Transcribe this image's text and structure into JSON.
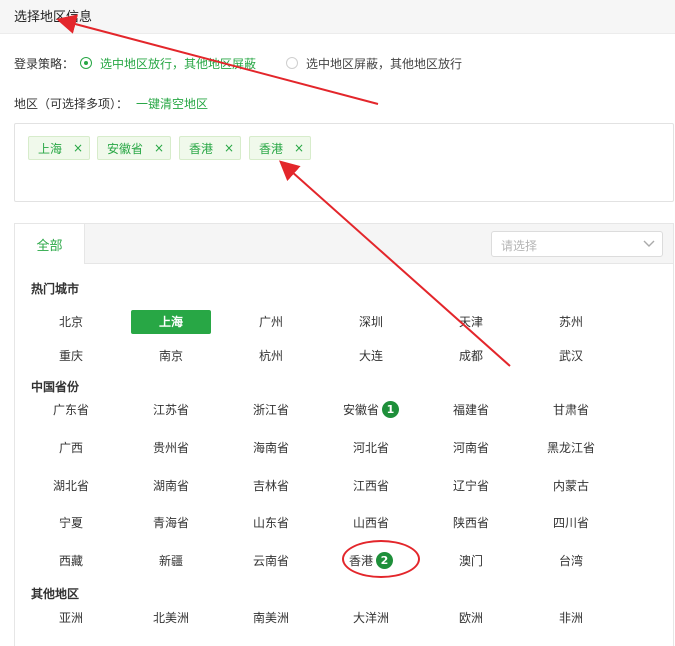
{
  "header": {
    "title": "选择地区信息"
  },
  "policy": {
    "label": "登录策略：",
    "options": [
      {
        "label": "选中地区放行，其他地区屏蔽",
        "selected": true
      },
      {
        "label": "选中地区屏蔽，其他地区放行",
        "selected": false
      }
    ]
  },
  "area": {
    "label": "地区（可选择多项）：",
    "clear_link": "一键清空地区"
  },
  "tags": [
    {
      "label": "上海",
      "close": "×"
    },
    {
      "label": "安徽省",
      "close": "×"
    },
    {
      "label": "香港",
      "close": "×"
    },
    {
      "label": "香港",
      "close": "×"
    }
  ],
  "panel": {
    "tab_all": "全部",
    "select_placeholder": "请选择",
    "sections": [
      {
        "title": "热门城市",
        "rows": [
          [
            "北京",
            "上海",
            "广州",
            "深圳",
            "天津",
            "苏州"
          ],
          [
            "重庆",
            "南京",
            "杭州",
            "大连",
            "成都",
            "武汉"
          ]
        ]
      },
      {
        "title": "中国省份",
        "rows": [
          [
            "广东省",
            "江苏省",
            "浙江省",
            "安徽省",
            "福建省",
            "甘肃省"
          ],
          [
            "广西",
            "贵州省",
            "海南省",
            "河北省",
            "河南省",
            "黑龙江省"
          ],
          [
            "湖北省",
            "湖南省",
            "吉林省",
            "江西省",
            "辽宁省",
            "内蒙古"
          ],
          [
            "宁夏",
            "青海省",
            "山东省",
            "山西省",
            "陕西省",
            "四川省"
          ],
          [
            "西藏",
            "新疆",
            "云南省",
            "香港",
            "澳门",
            "台湾"
          ]
        ]
      },
      {
        "title": "其他地区",
        "rows": [
          [
            "亚洲",
            "北美洲",
            "南美洲",
            "大洋洲",
            "欧洲",
            "非洲"
          ]
        ]
      }
    ],
    "badges": {
      "anhui": "1",
      "hongkong": "2"
    }
  },
  "colors": {
    "accent": "#28a745",
    "annotation": "#e3262b"
  }
}
